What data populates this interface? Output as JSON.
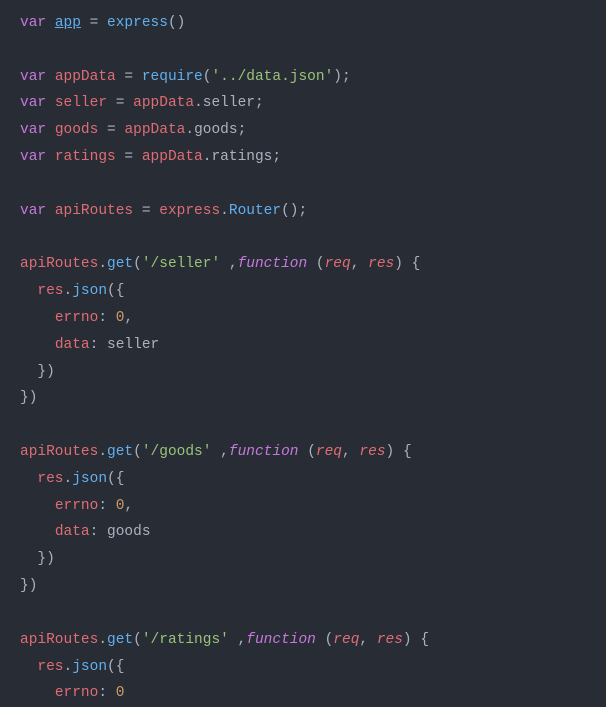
{
  "tokens": {
    "var": "var",
    "function": "function",
    "app": "app",
    "express": "express",
    "appData": "appData",
    "require": "require",
    "dataJsonPath": "'../data.json'",
    "seller": "seller",
    "goods": "goods",
    "ratings": "ratings",
    "apiRoutes": "apiRoutes",
    "Router": "Router",
    "get": "get",
    "sellerPath": "'/seller'",
    "goodsPath": "'/goods'",
    "ratingsPath": "'/ratings'",
    "req": "req",
    "res": "res",
    "json": "json",
    "errno": "errno",
    "data": "data",
    "zero": "0"
  },
  "p": {
    "eq": " = ",
    "lp": "(",
    "rp": ")",
    "lc": "{",
    "rc": "}",
    "semi": ";",
    "dot": ".",
    "comma": ", ",
    "colon": ": ",
    "spaceCommaSpace": " ,"
  },
  "indent": {
    "i1": "  ",
    "i2": "    "
  }
}
